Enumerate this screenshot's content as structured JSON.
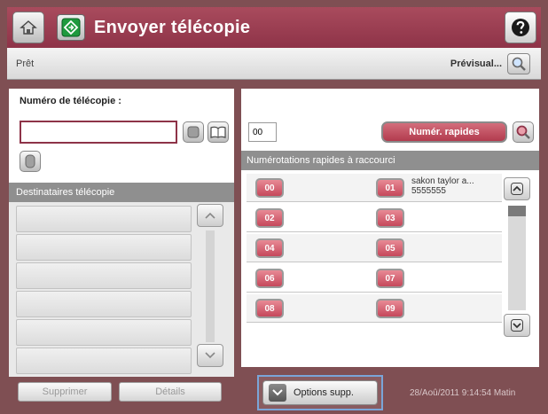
{
  "header": {
    "title": "Envoyer télécopie"
  },
  "statusbar": {
    "status": "Prêt",
    "preview_label": "Prévisual..."
  },
  "left": {
    "fax_number_label": "Numéro de télécopie :",
    "fax_number_value": "",
    "recipients_header": "Destinataires télécopie",
    "recipient_rows": [
      "",
      "",
      "",
      "",
      "",
      ""
    ],
    "delete_label": "Supprimer",
    "details_label": "Détails"
  },
  "right": {
    "speed_input_value": "00",
    "speed_dial_button_label": "Numér. rapides",
    "shortcut_header": "Numérotations rapides à raccourci",
    "rows": [
      {
        "left_code": "00",
        "right_code": "01",
        "name_line1": "sakon taylor a...",
        "name_line2": "5555555"
      },
      {
        "left_code": "02",
        "right_code": "03",
        "name_line1": "",
        "name_line2": ""
      },
      {
        "left_code": "04",
        "right_code": "05",
        "name_line1": "",
        "name_line2": ""
      },
      {
        "left_code": "06",
        "right_code": "07",
        "name_line1": "",
        "name_line2": ""
      },
      {
        "left_code": "08",
        "right_code": "09",
        "name_line1": "",
        "name_line2": ""
      }
    ]
  },
  "footer": {
    "options_label": "Options supp.",
    "datetime": "28/Aoû/2011 9:14:54 Matin"
  },
  "colors": {
    "header_bg": "#9b3d52",
    "frame_bg": "#7f4f53",
    "speed_dial_red": "#c5485b",
    "input_border": "#8e3348",
    "options_highlight": "#7aa5d8"
  }
}
